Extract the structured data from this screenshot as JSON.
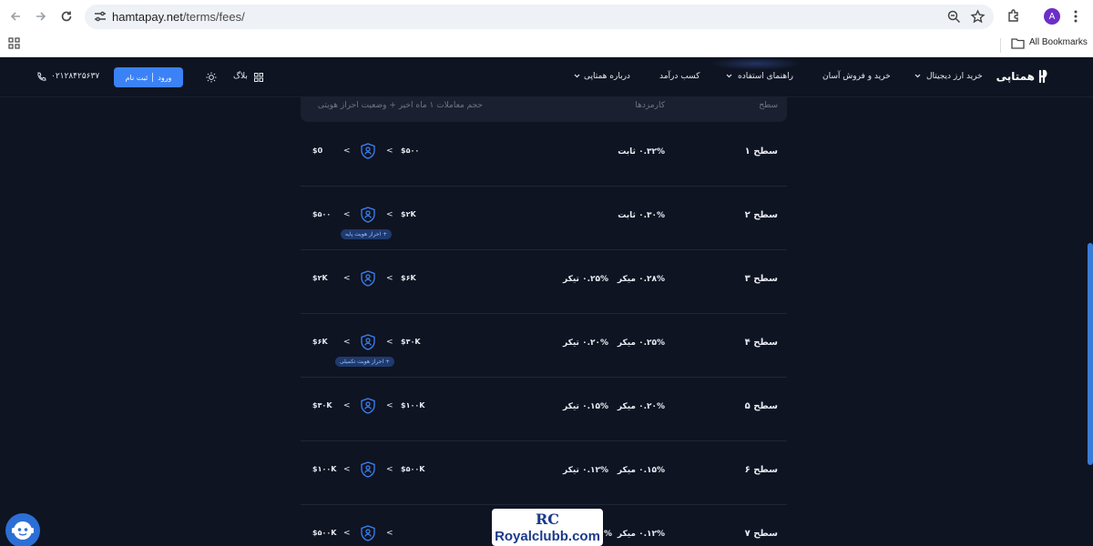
{
  "browser": {
    "url_host": "hamtapay.net",
    "url_path": "/terms/fees/",
    "avatar_letter": "A",
    "bookmarks_label": "All Bookmarks"
  },
  "header": {
    "logo_text": "همتاپی",
    "nav": {
      "buy_digital": "خرید ارز دیجیتال",
      "buy_sell_easy": "خرید و فروش آسان",
      "guide": "راهنمای استفاده",
      "earn": "کسب درآمد",
      "about": "درباره همتاپی",
      "blog": "بلاگ"
    },
    "login": "ورود",
    "signup": "ثبت نام",
    "phone": "۰۲۱۲۸۴۲۵۶۳۷"
  },
  "table": {
    "headers": {
      "level": "سطح",
      "fees": "کارمزدها",
      "volume": "حجم معاملات ۱ ماه اخیر + وضعیت احراز هویتی"
    },
    "rows": [
      {
        "level": "سطح ۱",
        "maker": "۰.۳۲% ثابت",
        "taker": "",
        "min": "$0",
        "max": "$۵۰۰",
        "badge": ""
      },
      {
        "level": "سطح ۲",
        "maker": "۰.۳۰% ثابت",
        "taker": "",
        "min": "$۵۰۰",
        "max": "$۲K",
        "badge": "+ احراز هویت پایه"
      },
      {
        "level": "سطح ۳",
        "maker": "۰.۲۸% میکر",
        "taker": "۰.۲۵% تیکر",
        "min": "$۲K",
        "max": "$۶K",
        "badge": ""
      },
      {
        "level": "سطح ۴",
        "maker": "۰.۲۵% میکر",
        "taker": "۰.۲۰% تیکر",
        "min": "$۶K",
        "max": "$۳۰K",
        "badge": "+ احراز هویت تکمیلی"
      },
      {
        "level": "سطح ۵",
        "maker": "۰.۲۰% میکر",
        "taker": "۰.۱۵% تیکر",
        "min": "$۳۰K",
        "max": "$۱۰۰K",
        "badge": ""
      },
      {
        "level": "سطح ۶",
        "maker": "۰.۱۵% میکر",
        "taker": "۰.۱۲% تیکر",
        "min": "$۱۰۰K",
        "max": "$۵۰۰K",
        "badge": ""
      },
      {
        "level": "سطح ۷",
        "maker": "۰.۱۲% میکر",
        "taker": "%",
        "min": "$۵۰۰K",
        "max": "",
        "badge": ""
      }
    ]
  },
  "watermark": {
    "mark": "RC",
    "site": "Royalclubb.com"
  }
}
